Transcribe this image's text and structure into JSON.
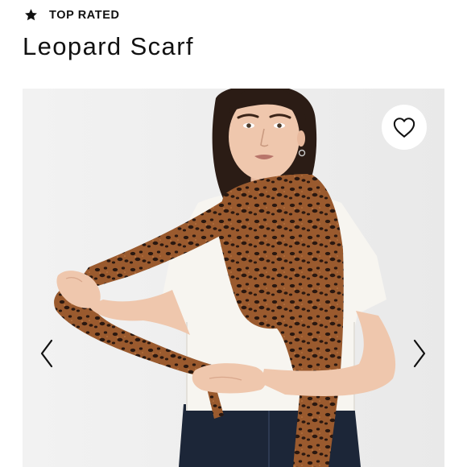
{
  "header": {
    "badge_icon": "star-icon",
    "badge_label": "TOP RATED",
    "title": "Leopard Scarf"
  },
  "gallery": {
    "favorite_icon": "heart-outline-icon",
    "prev_icon": "chevron-left-icon",
    "next_icon": "chevron-right-icon"
  },
  "colors": {
    "background": "#ffffff",
    "photo_background": "#efefef",
    "text": "#111111",
    "scarf_base": "#9a5a2e",
    "scarf_spots": "#2a1810"
  }
}
